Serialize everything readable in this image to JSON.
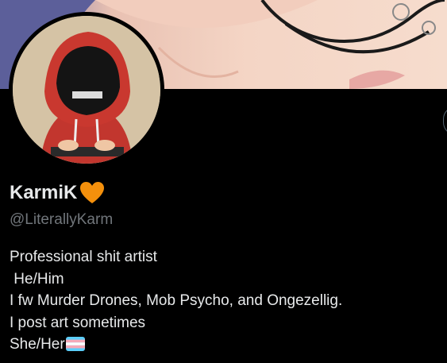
{
  "profile": {
    "display_name": "KarmiK",
    "name_badge_icon": "orange-heart-icon",
    "handle": "@LiterallyKarm",
    "bio": {
      "line1": "Professional shit artist",
      "line2": " He/Him",
      "line3": "I fw Murder Drones, Mob Psycho, and Ongezellig.",
      "line4": "I post art sometimes",
      "line5": "She/Her",
      "line5_icon": "transgender-flag-icon"
    }
  },
  "colors": {
    "background": "#000000",
    "text_primary": "#e7e9ea",
    "text_secondary": "#71767b",
    "heart": "#f4900c"
  }
}
